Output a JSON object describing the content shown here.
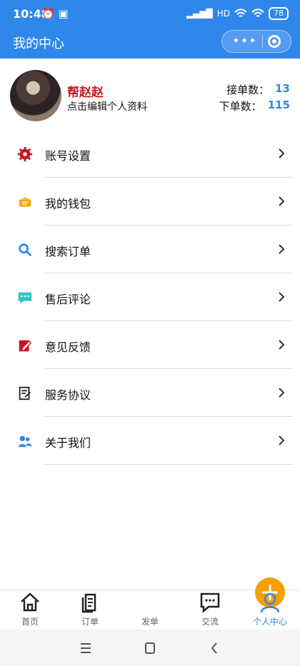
{
  "status_bar": {
    "time": "10:48",
    "status_glyphs": "⏰ ▣",
    "signal": "▂▄▆█",
    "network": "HD",
    "battery": "78"
  },
  "header": {
    "title": "我的中心"
  },
  "profile": {
    "name": "帮赵赵",
    "edit_text": "点击编辑个人资料",
    "accepted_label": "接单数：",
    "accepted_count": "13",
    "posted_label": "下单数：",
    "posted_count": "115"
  },
  "menu": [
    {
      "label": "账号设置",
      "icon": "gear-icon",
      "color": "#c8161e"
    },
    {
      "label": "我的钱包",
      "icon": "wallet-icon",
      "color": "#f0a800"
    },
    {
      "label": "搜索订单",
      "icon": "search-icon",
      "color": "#2f87ec"
    },
    {
      "label": "售后评论",
      "icon": "comment-icon",
      "color": "#28c8c0"
    },
    {
      "label": "意见反馈",
      "icon": "feedback-icon",
      "color": "#c8161e"
    },
    {
      "label": "服务协议",
      "icon": "agreement-icon",
      "color": "#222222"
    },
    {
      "label": "关于我们",
      "icon": "users-icon",
      "color": "#2f87ec"
    }
  ],
  "tabbar": {
    "home": "首页",
    "orders": "订单",
    "publish": "发单",
    "chat": "交流",
    "profile": "个人中心"
  },
  "colors": {
    "primary": "#2f87ec",
    "accent": "#f4a006",
    "name": "#c8161e"
  }
}
